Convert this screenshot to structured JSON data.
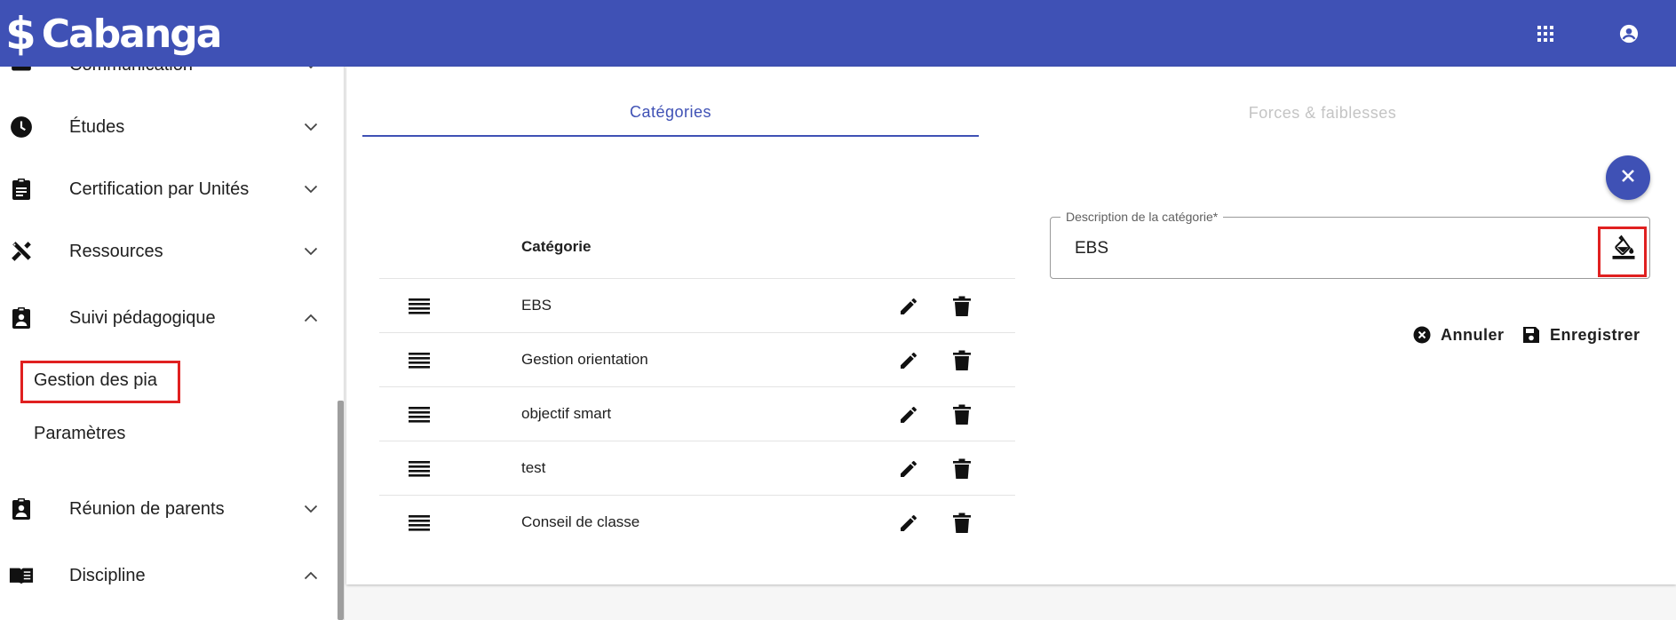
{
  "app": {
    "dollar": "$",
    "brand": "Cabanga"
  },
  "sidebar": {
    "items": [
      {
        "label": "Communication",
        "icon": "message-icon",
        "chevron": "down"
      },
      {
        "label": "Études",
        "icon": "clock-icon",
        "chevron": "down"
      },
      {
        "label": "Certification par Unités",
        "icon": "clipboard-icon",
        "chevron": "down"
      },
      {
        "label": "Ressources",
        "icon": "tools-icon",
        "chevron": "down"
      },
      {
        "label": "Suivi pédagogique",
        "icon": "assignment-ind-icon",
        "chevron": "up"
      },
      {
        "label": "Réunion de parents",
        "icon": "assignment-ind-icon",
        "chevron": "down"
      },
      {
        "label": "Discipline",
        "icon": "book-icon",
        "chevron": "up"
      }
    ],
    "subitems": [
      {
        "label": "Gestion des pia"
      },
      {
        "label": "Paramètres"
      }
    ]
  },
  "tabs": [
    {
      "label": "Catégories",
      "active": true
    },
    {
      "label": "Forces & faiblesses",
      "active": false
    }
  ],
  "table": {
    "header": "Catégorie",
    "rows": [
      {
        "name": "EBS"
      },
      {
        "name": "Gestion orientation"
      },
      {
        "name": "objectif smart"
      },
      {
        "name": "test"
      },
      {
        "name": "Conseil de classe"
      }
    ]
  },
  "form": {
    "label": "Description de la catégorie*",
    "value": "EBS"
  },
  "actions": {
    "cancel": "Annuler",
    "save": "Enregistrer"
  },
  "colors": {
    "primary": "#3f51b5",
    "highlight": "#e02020"
  }
}
